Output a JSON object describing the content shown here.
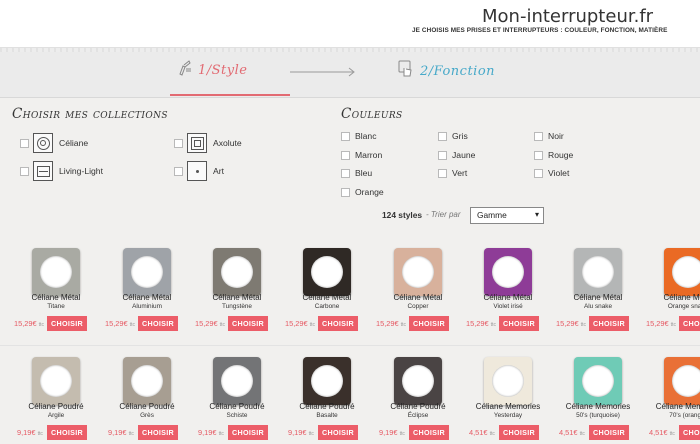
{
  "header": {
    "title": "Mon-interrupteur.fr",
    "tagline": "JE CHOISIS MES PRISES ET INTERRUPTEURS : COULEUR, FONCTION, MATIÈRE"
  },
  "steps": [
    {
      "label": "1/Style",
      "icon": "brush-icon",
      "color": "#e26a72"
    },
    {
      "label": "2/Fonction",
      "icon": "hand-press-icon",
      "color": "#47a9c9"
    }
  ],
  "collections": {
    "heading": "Choisir mes collections",
    "items": [
      {
        "label": "Céliane",
        "icon": "celiane-switch-icon"
      },
      {
        "label": "Axolute",
        "icon": "axolute-switch-icon"
      },
      {
        "label": "Living-Light",
        "icon": "living-light-switch-icon"
      },
      {
        "label": "Art",
        "icon": "art-switch-icon"
      }
    ]
  },
  "colors": {
    "heading": "Couleurs",
    "items": [
      "Blanc",
      "Gris",
      "Noir",
      "Marron",
      "Jaune",
      "Rouge",
      "Bleu",
      "Vert",
      "Violet",
      "Orange"
    ]
  },
  "sort": {
    "count": "124 styles",
    "label": "- Trier par",
    "selected": "Gamme"
  },
  "products": [
    {
      "name": "Céliane Métal",
      "sub": "Titane",
      "price": "15,29€",
      "ttc": "ttc",
      "button": "CHOISIR",
      "color": "#a9aaa3"
    },
    {
      "name": "Céliane Métal",
      "sub": "Aluminium",
      "price": "15,29€",
      "ttc": "ttc",
      "button": "CHOISIR",
      "color": "#9fa3a8"
    },
    {
      "name": "Céliane Métal",
      "sub": "Tungstène",
      "price": "15,29€",
      "ttc": "ttc",
      "button": "CHOISIR",
      "color": "#7e7a72"
    },
    {
      "name": "Céliane Métal",
      "sub": "Carbone",
      "price": "15,29€",
      "ttc": "ttc",
      "button": "CHOISIR",
      "color": "#2f2925"
    },
    {
      "name": "Céliane Métal",
      "sub": "Copper",
      "price": "15,29€",
      "ttc": "ttc",
      "button": "CHOISIR",
      "color": "#d8b19c"
    },
    {
      "name": "Céliane Métal",
      "sub": "Violet irisé",
      "price": "15,29€",
      "ttc": "ttc",
      "button": "CHOISIR",
      "color": "#8e3c97"
    },
    {
      "name": "Céliane Métal",
      "sub": "Alu snake",
      "price": "15,29€",
      "ttc": "ttc",
      "button": "CHOISIR",
      "color": "#b4b6b6"
    },
    {
      "name": "Céliane Métal",
      "sub": "Orange snake",
      "price": "15,29€",
      "ttc": "ttc",
      "button": "CHOISIR",
      "color": "#ea6a24"
    },
    {
      "name": "Céliane Poudré",
      "sub": "Argile",
      "price": "9,19€",
      "ttc": "ttc",
      "button": "CHOISIR",
      "color": "#c4bcaf"
    },
    {
      "name": "Céliane Poudré",
      "sub": "Grès",
      "price": "9,19€",
      "ttc": "ttc",
      "button": "CHOISIR",
      "color": "#a79e92"
    },
    {
      "name": "Céliane Poudré",
      "sub": "Schiste",
      "price": "9,19€",
      "ttc": "ttc",
      "button": "CHOISIR",
      "color": "#737476"
    },
    {
      "name": "Céliane Poudré",
      "sub": "Basalte",
      "price": "9,19€",
      "ttc": "ttc",
      "button": "CHOISIR",
      "color": "#3a302b"
    },
    {
      "name": "Céliane Poudré",
      "sub": "Éclipse",
      "price": "9,19€",
      "ttc": "ttc",
      "button": "CHOISIR",
      "color": "#4a4444"
    },
    {
      "name": "Céliane Memories",
      "sub": "Yesterday",
      "price": "4,51€",
      "ttc": "ttc",
      "button": "CHOISIR",
      "color": "#efe9dc"
    },
    {
      "name": "Céliane Memories",
      "sub": "50's (turquoise)",
      "price": "4,51€",
      "ttc": "ttc",
      "button": "CHOISIR",
      "color": "#6fcbb6"
    },
    {
      "name": "Céliane Memories",
      "sub": "70's (orange)",
      "price": "4,51€",
      "ttc": "ttc",
      "button": "CHOISIR",
      "color": "#e97036"
    }
  ]
}
